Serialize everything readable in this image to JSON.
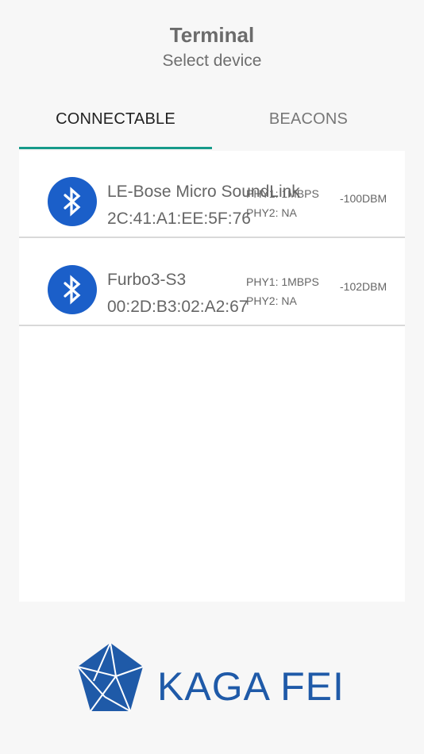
{
  "header": {
    "title": "Terminal",
    "subtitle": "Select device"
  },
  "tabs": [
    {
      "label": "CONNECTABLE",
      "selected": true
    },
    {
      "label": "BEACONS",
      "selected": false
    }
  ],
  "devices": [
    {
      "name": "LE-Bose Micro SoundLink",
      "address": "2C:41:A1:EE:5F:76",
      "phy1": "PHY1: 1MBPS",
      "phy2": "PHY2: NA",
      "rssi": "-100DBM",
      "icon": "bluetooth-icon"
    },
    {
      "name": "Furbo3-S3",
      "address": "00:2D:B3:02:A2:67",
      "phy1": "PHY1: 1MBPS",
      "phy2": "PHY2: NA",
      "rssi": "-102DBM",
      "icon": "bluetooth-icon"
    }
  ],
  "logo": {
    "text": "KAGA FEI"
  },
  "colors": {
    "accent": "#169a8a",
    "bluetooth": "#1b5fc9",
    "brand": "#1f5aa8"
  }
}
